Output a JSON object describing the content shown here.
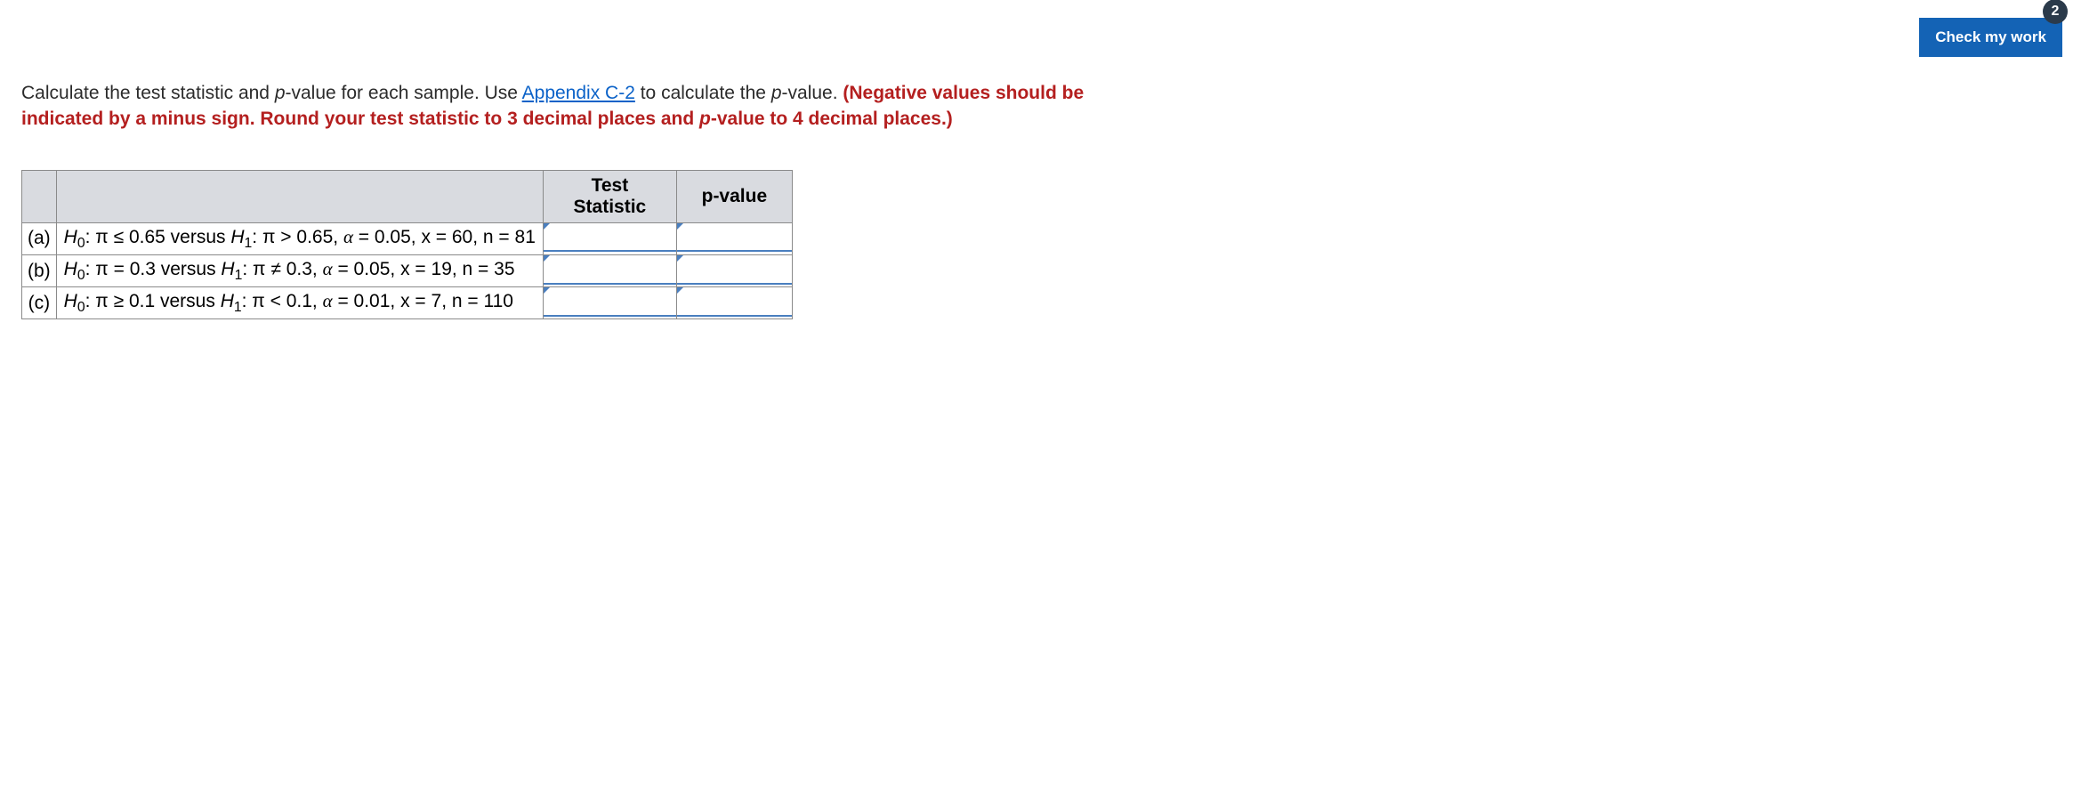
{
  "header": {
    "check_work_label": "Check my work",
    "badge_value": "2"
  },
  "instructions": {
    "text_part1": "Calculate the test statistic and ",
    "text_pvalue1": "p",
    "text_part2": "-value for each sample. Use ",
    "appendix_link": "Appendix C-2",
    "text_part3": " to calculate the ",
    "text_pvalue2": "p",
    "text_part4": "-value. ",
    "red_text_part1": "(Negative values should be indicated by a minus sign. Round your test statistic to 3 decimal places and ",
    "red_pvalue": "p",
    "red_text_part2": "-value to 4 decimal places.)"
  },
  "table": {
    "header_stat": "Test Statistic",
    "header_pval_prefix": "p",
    "header_pval_suffix": "-value",
    "rows": [
      {
        "label": "(a)",
        "h0_prefix": "H",
        "h0_sub": "0",
        "h0_rel": ": π ≤ 0.65 versus ",
        "h1_prefix": "H",
        "h1_sub": "1",
        "h1_rel": ": π > 0.65, ",
        "alpha": "α",
        "params": " = 0.05, x = 60, n = 81",
        "stat_value": "",
        "pval_value": ""
      },
      {
        "label": "(b)",
        "h0_prefix": "H",
        "h0_sub": "0",
        "h0_rel": ": π = 0.3 versus ",
        "h1_prefix": "H",
        "h1_sub": "1",
        "h1_rel": ": π ≠ 0.3, ",
        "alpha": "α",
        "params": " = 0.05, x = 19, n = 35",
        "stat_value": "",
        "pval_value": ""
      },
      {
        "label": "(c)",
        "h0_prefix": "H",
        "h0_sub": "0",
        "h0_rel": ": π ≥ 0.1 versus ",
        "h1_prefix": "H",
        "h1_sub": "1",
        "h1_rel": ": π < 0.1, ",
        "alpha": "α",
        "params": " = 0.01, x = 7, n = 110",
        "stat_value": "",
        "pval_value": ""
      }
    ]
  }
}
